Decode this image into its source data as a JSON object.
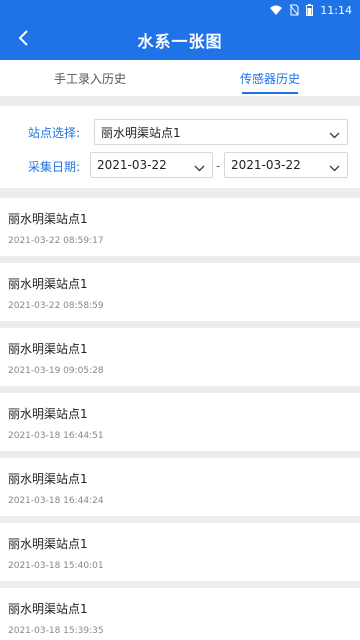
{
  "status_bar": {
    "time": "11:14",
    "icons": [
      "wifi-icon",
      "no-sim-icon",
      "battery-icon"
    ]
  },
  "header": {
    "title": "水系一张图",
    "back_icon": "chevron-left-icon"
  },
  "tabs": [
    {
      "label": "手工录入历史",
      "active": false
    },
    {
      "label": "传感器历史",
      "active": true
    }
  ],
  "filter": {
    "station_label": "站点选择:",
    "station_value": "丽水明渠站点1",
    "date_label": "采集日期:",
    "start_date": "2021-03-22",
    "separator": "-",
    "end_date": "2021-03-22"
  },
  "records": [
    {
      "name": "丽水明渠站点1",
      "time": "2021-03-22 08:59:17"
    },
    {
      "name": "丽水明渠站点1",
      "time": "2021-03-22 08:58:59"
    },
    {
      "name": "丽水明渠站点1",
      "time": "2021-03-19 09:05:28"
    },
    {
      "name": "丽水明渠站点1",
      "time": "2021-03-18 16:44:51"
    },
    {
      "name": "丽水明渠站点1",
      "time": "2021-03-18 16:44:24"
    },
    {
      "name": "丽水明渠站点1",
      "time": "2021-03-18 15:40:01"
    },
    {
      "name": "丽水明渠站点1",
      "time": "2021-03-18 15:39:35"
    }
  ],
  "colors": {
    "primary": "#1f73e6",
    "background": "#ededed"
  }
}
